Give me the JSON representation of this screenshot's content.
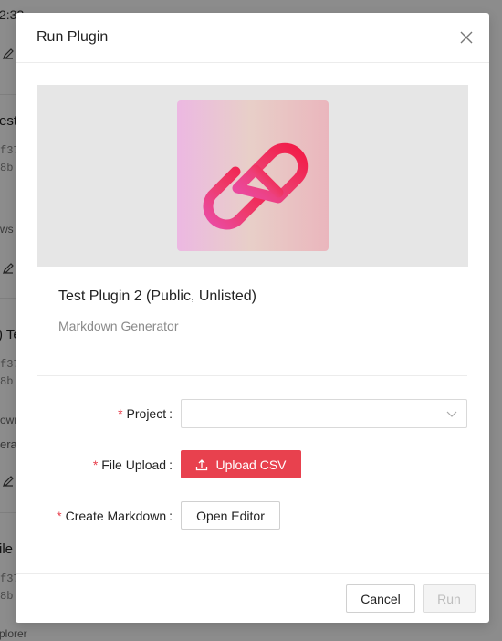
{
  "background": {
    "fragments": [
      "2:33",
      "est",
      "f37",
      "8b",
      "ws",
      ") Te",
      "f37",
      "8b",
      "own",
      "era",
      "ile",
      "f37",
      "8b",
      "plorer"
    ]
  },
  "modal": {
    "title": "Run Plugin",
    "close_icon": "close-icon",
    "plugin": {
      "name": "Test Plugin 2 (Public, Unlisted)",
      "type": "Markdown Generator",
      "logo_icon": "link-icon",
      "logo_colors": [
        "#ea3f8c",
        "#f21a4b"
      ]
    },
    "form": {
      "project_label": "Project",
      "project_value": "",
      "file_upload_label": "File Upload",
      "upload_button_label": "Upload CSV",
      "create_markdown_label": "Create Markdown",
      "open_editor_label": "Open Editor",
      "required_marker": "*",
      "colon": ":"
    },
    "footer": {
      "cancel_label": "Cancel",
      "run_label": "Run"
    }
  },
  "colors": {
    "accent": "#e8414e",
    "overlay": "rgba(0,0,0,0.45)"
  }
}
